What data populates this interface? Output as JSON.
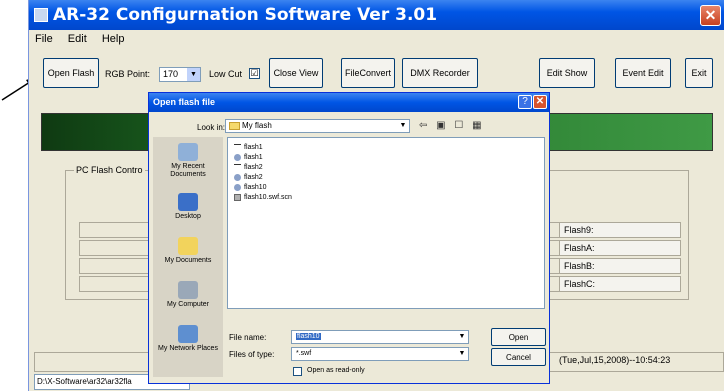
{
  "app": {
    "title": "AR-32 Configurnation Software Ver 3.01",
    "close_glyph": "✕"
  },
  "menu": {
    "items": [
      "File",
      "Edit",
      "Help"
    ]
  },
  "toolbar": {
    "open_flash": "Open Flash",
    "rgb_point_label": "RGB Point:",
    "rgb_point_value": "170",
    "low_cut_label": "Low Cut",
    "low_cut_checked": "☑",
    "close_view": "Close View",
    "file_convert": "FileConvert",
    "dmx_recorder": "DMX Recorder",
    "edit_show": "Edit Show",
    "event_edit": "Event Edit",
    "exit": "Exit"
  },
  "panel": {
    "group_title": "PC Flash Contro",
    "row_prefix": "F",
    "flash_cells": [
      "Flash9:",
      "FlashA:",
      "FlashB:",
      "FlashC:"
    ]
  },
  "status": {
    "datetime": "(Tue,Jul,15,2008)--10:54:23",
    "path": "D:\\X-Software\\ar32\\ar32fla"
  },
  "dialog": {
    "title": "Open flash file",
    "help_glyph": "?",
    "close_glyph": "✕",
    "look_in_label": "Look in:",
    "look_in_value": "My flash",
    "toolbar_icons": "⇦ ▣ ☐ ▦",
    "places": [
      "My Recent Documents",
      "Desktop",
      "My Documents",
      "My Computer",
      "My Network Places"
    ],
    "files": [
      "flash1",
      "flash1",
      "flash2",
      "flash2",
      "flash10",
      "flash10.swf.scn"
    ],
    "file_name_label": "File name:",
    "file_name_value": "flash10",
    "files_of_type_label": "Files of type:",
    "files_of_type_value": "*.swf",
    "open_button": "Open",
    "cancel_button": "Cancel",
    "read_only_label": "Open as read-only"
  },
  "colors": {
    "titlebar": "#0055e5",
    "banner": "#1d6a23",
    "selection": "#316ac5"
  }
}
